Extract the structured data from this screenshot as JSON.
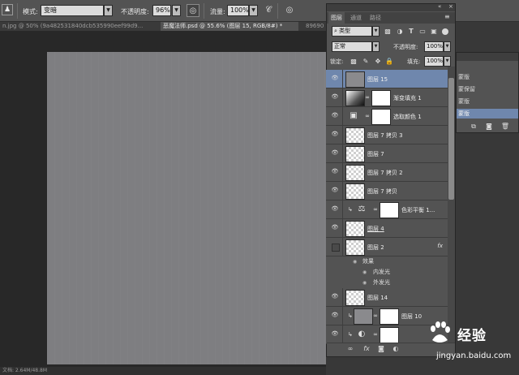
{
  "options_bar": {
    "tool_preset_glyph": "♟",
    "mode_label": "模式:",
    "mode_value": "变暗",
    "opacity_label": "不透明度:",
    "opacity_value": "96%",
    "flow_label": "流量:",
    "flow_value": "100%"
  },
  "document_tabs": [
    {
      "label": "n.jpg @ 50% (9a482531840dcb535990eef99d9...",
      "active": false
    },
    {
      "label": "恶魔法师.psd @ 55.6% (图层 15, RGB/8#) *",
      "active": true
    },
    {
      "label": "89690",
      "active": false
    }
  ],
  "status_bar": {
    "text": "文档: 2.64M/48.8M"
  },
  "layers_panel": {
    "tabs": [
      {
        "label": "图层",
        "active": true
      },
      {
        "label": "通道",
        "active": false
      },
      {
        "label": "路径",
        "active": false
      }
    ],
    "filter_kind": "类型",
    "blend_mode": "正常",
    "opacity_label": "不透明度:",
    "opacity_value": "100%",
    "lock_label": "锁定:",
    "fill_label": "填充:",
    "fill_value": "100%",
    "layers": [
      {
        "name": "图层 15",
        "thumb": "gray",
        "selected": true,
        "visible": true
      },
      {
        "name": "渐变填充 1",
        "thumb": "grad",
        "mask": true,
        "visible": true
      },
      {
        "name": "选取颜色 1",
        "thumb": "adjust",
        "adj_glyph": "▣",
        "mask": true,
        "visible": true
      },
      {
        "name": "图层 7 拷贝 3",
        "thumb": "checker",
        "visible": true
      },
      {
        "name": "图层 7",
        "thumb": "checker",
        "visible": true
      },
      {
        "name": "图层 7 拷贝 2",
        "thumb": "checker",
        "visible": true
      },
      {
        "name": "图层 7 拷贝",
        "thumb": "checker",
        "visible": true
      },
      {
        "name": "色彩平衡 1...",
        "thumb": "adjust",
        "adj_glyph": "⚖",
        "mask": true,
        "clip": true,
        "visible": true
      },
      {
        "name": "图层 4",
        "thumb": "checker",
        "visible": true,
        "underline": true
      },
      {
        "name": "图层 2",
        "thumb": "checker",
        "visible": false,
        "fx": true
      },
      {
        "name": "图层 14",
        "thumb": "checker",
        "visible": true
      },
      {
        "name": "图层 10",
        "thumb": "gray",
        "mask": true,
        "clip": true,
        "visible": true
      },
      {
        "name": "",
        "thumb": "adjust",
        "adj_glyph": "◐",
        "mask": true,
        "clip": true,
        "visible": true
      }
    ],
    "effects_label": "效果",
    "effects": [
      "内发光",
      "外发光"
    ],
    "footer_icons": [
      "link-icon",
      "fx-icon",
      "mask-icon",
      "adjustment-icon",
      "group-icon",
      "new-layer-icon",
      "trash-icon"
    ]
  },
  "history_panel": {
    "items": [
      {
        "label": "蒙版",
        "selected": false
      },
      {
        "label": "蒙保留",
        "selected": false
      },
      {
        "label": "蒙版",
        "selected": false
      },
      {
        "label": "蒙版",
        "selected": true
      }
    ]
  },
  "watermark": {
    "text": "经验",
    "url": "jingyan.baidu.com"
  },
  "colors": {
    "selection": "#6f87ad",
    "panel": "#535353",
    "canvas": "#7e7e81"
  }
}
